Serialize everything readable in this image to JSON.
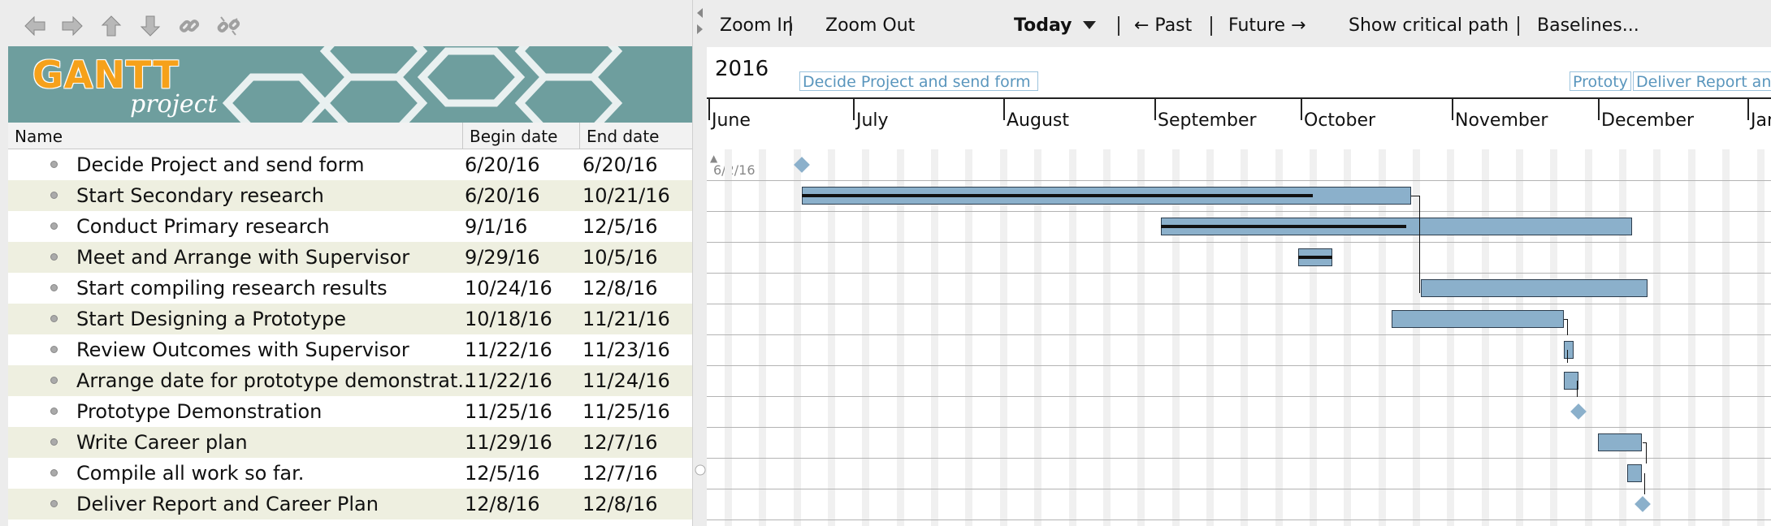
{
  "toolbar": {
    "icons": [
      "arrow-left-icon",
      "arrow-right-icon",
      "arrow-up-icon",
      "arrow-down-icon",
      "link-icon",
      "unlink-icon"
    ]
  },
  "banner": {
    "logo_main": "GANTT",
    "logo_sub": "project"
  },
  "table": {
    "columns": [
      "Name",
      "Begin date",
      "End date"
    ],
    "rows": [
      {
        "name": "Decide Project and send form",
        "begin": "6/20/16",
        "end": "6/20/16"
      },
      {
        "name": "Start Secondary research",
        "begin": "6/20/16",
        "end": "10/21/16"
      },
      {
        "name": "Conduct Primary research",
        "begin": "9/1/16",
        "end": "12/5/16"
      },
      {
        "name": "Meet and Arrange with Supervisor",
        "begin": "9/29/16",
        "end": "10/5/16"
      },
      {
        "name": "Start compiling research results",
        "begin": "10/24/16",
        "end": "12/8/16"
      },
      {
        "name": "Start Designing a Prototype",
        "begin": "10/18/16",
        "end": "11/21/16"
      },
      {
        "name": "Review Outcomes with Supervisor",
        "begin": "11/22/16",
        "end": "11/23/16"
      },
      {
        "name": "Arrange date for prototype demonstrat...",
        "begin": "11/22/16",
        "end": "11/24/16"
      },
      {
        "name": "Prototype Demonstration",
        "begin": "11/25/16",
        "end": "11/25/16"
      },
      {
        "name": "Write Career plan",
        "begin": "11/29/16",
        "end": "12/7/16"
      },
      {
        "name": "Compile all work so far.",
        "begin": "12/5/16",
        "end": "12/7/16"
      },
      {
        "name": "Deliver Report and Career Plan",
        "begin": "12/8/16",
        "end": "12/8/16"
      }
    ]
  },
  "chart_toolbar": {
    "zoom_in": "Zoom In",
    "zoom_out": "Zoom Out",
    "today": "Today",
    "past": "← Past",
    "future": "Future →",
    "critical_path": "Show critical path",
    "baselines": "Baselines..."
  },
  "timeline": {
    "year": "2016",
    "months": [
      "June",
      "July",
      "August",
      "September",
      "October",
      "November",
      "December",
      "Jan"
    ],
    "first_date": "6/2/16",
    "milestone_chips": [
      "Decide Project and send form",
      "Prototy",
      "Deliver Report an"
    ]
  },
  "colors": {
    "bar": "#8bb0cb",
    "banner": "#6e9e9e",
    "alt_row": "#eeefe0",
    "logo": "#f6a11a"
  }
}
